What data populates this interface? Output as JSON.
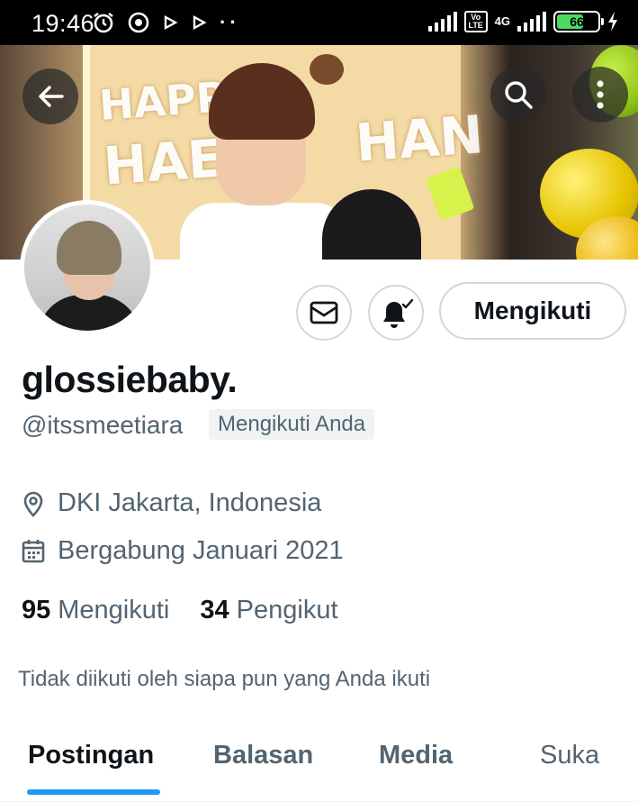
{
  "status_bar": {
    "time": "19:46",
    "network": "4G",
    "volte": "Vo LTE",
    "battery": "66"
  },
  "profile": {
    "display_name": "glossiebaby.",
    "handle": "@itssmeetiara",
    "follows_you_badge": "Mengikuti Anda",
    "location": "DKI Jakarta, Indonesia",
    "joined": "Bergabung Januari 2021",
    "following_count": "95",
    "following_label": "Mengikuti",
    "followers_count": "34",
    "followers_label": "Pengikut",
    "mutual_note": "Tidak diikuti oleh siapa pun yang Anda ikuti"
  },
  "actions": {
    "follow_button": "Mengikuti"
  },
  "tabs": [
    {
      "label": "Postingan",
      "active": true
    },
    {
      "label": "Balasan",
      "active": false
    },
    {
      "label": "Media",
      "active": false
    },
    {
      "label": "Suka",
      "active": false
    }
  ],
  "colors": {
    "accent": "#1d9bf0",
    "text_primary": "#0f1419",
    "text_secondary": "#536471",
    "border": "#cfd9de"
  },
  "icons": {
    "back": "arrow-left-icon",
    "search": "search-icon",
    "more": "more-vertical-icon",
    "message": "envelope-icon",
    "notify": "bell-check-icon",
    "location": "location-pin-icon",
    "calendar": "calendar-icon"
  }
}
